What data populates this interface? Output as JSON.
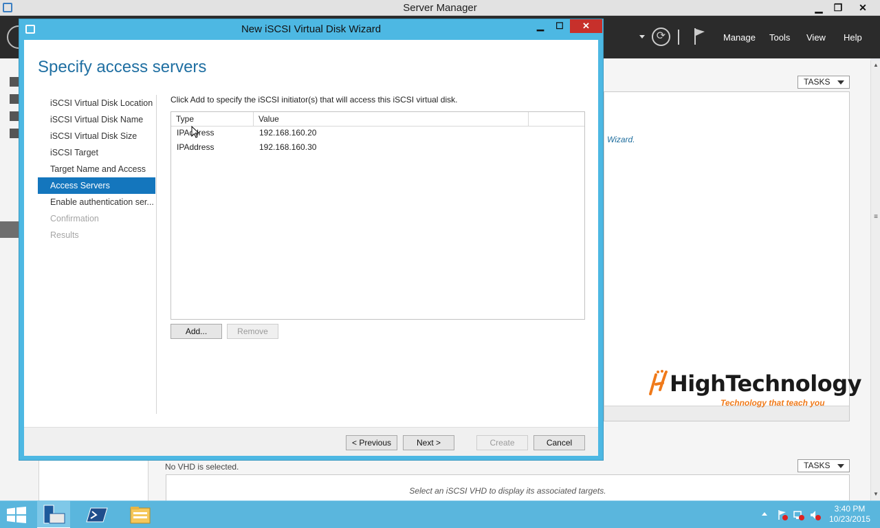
{
  "server_manager": {
    "title": "Server Manager",
    "window_controls": {
      "minimize": "▁",
      "restore": "❐",
      "close": "✕"
    },
    "menu": [
      "Manage",
      "Tools",
      "View",
      "Help"
    ],
    "tasks_label": "TASKS",
    "wizard_link_fragment": "Wizard.",
    "no_vhd_text": "No VHD is selected.",
    "target_panel_message": "Select an iSCSI VHD to display its associated targets."
  },
  "wizard": {
    "title": "New iSCSI Virtual Disk Wizard",
    "window_controls": {
      "minimize": "▁",
      "maximize": "☐",
      "close": "✕"
    },
    "heading": "Specify access servers",
    "steps": [
      {
        "label": "iSCSI Virtual Disk Location",
        "state": "normal"
      },
      {
        "label": "iSCSI Virtual Disk Name",
        "state": "normal"
      },
      {
        "label": "iSCSI Virtual Disk Size",
        "state": "normal"
      },
      {
        "label": "iSCSI Target",
        "state": "normal"
      },
      {
        "label": "Target Name and Access",
        "state": "normal"
      },
      {
        "label": "Access Servers",
        "state": "active"
      },
      {
        "label": "Enable authentication ser...",
        "state": "normal"
      },
      {
        "label": "Confirmation",
        "state": "disabled"
      },
      {
        "label": "Results",
        "state": "disabled"
      }
    ],
    "instruction": "Click Add to specify the iSCSI initiator(s) that will access this iSCSI virtual disk.",
    "grid": {
      "columns": [
        "Type",
        "Value",
        ""
      ],
      "rows": [
        {
          "type": "IPAddress",
          "value": "192.168.160.20"
        },
        {
          "type": "IPAddress",
          "value": "192.168.160.30"
        }
      ]
    },
    "buttons": {
      "add": "Add...",
      "remove": "Remove",
      "previous": "< Previous",
      "next": "Next >",
      "create": "Create",
      "cancel": "Cancel"
    }
  },
  "logo": {
    "name": "HighTechnology",
    "tagline": "Technology that teach you"
  },
  "taskbar": {
    "time": "3:40 PM",
    "date": "10/23/2015"
  },
  "colors": {
    "wizard_frame": "#4db8e3",
    "active_step": "#1476bd",
    "heading": "#1f6fa2",
    "taskbar": "#5ab6dd",
    "logo_orange": "#f07a1a"
  }
}
